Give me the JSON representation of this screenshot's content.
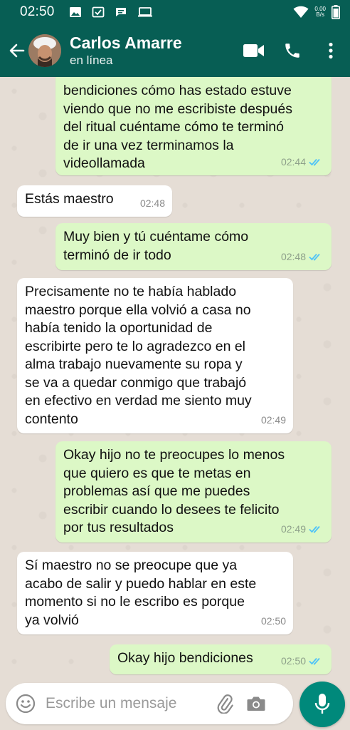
{
  "status_bar": {
    "time": "02:50",
    "net_speed_value": "0.00",
    "net_speed_unit": "B/s",
    "icons": [
      "gallery-icon",
      "checkbox-icon",
      "message-icon",
      "laptop-icon",
      "wifi-icon",
      "battery-icon"
    ]
  },
  "header": {
    "contact_name": "Carlos Amarre",
    "contact_status": "en línea",
    "icons": [
      "back-arrow-icon",
      "video-call-icon",
      "phone-icon",
      "more-options-icon"
    ]
  },
  "messages": [
    {
      "direction": "out",
      "text": "bendiciones cómo has estado estuve\nviendo que no me escribiste después\ndel ritual cuéntame cómo te terminó\nde ir una vez terminamos la\nvideollamada",
      "time": "02:44",
      "read": true
    },
    {
      "direction": "in",
      "text": "Estás maestro",
      "time": "02:48"
    },
    {
      "direction": "out",
      "text": "Muy bien y tú cuéntame cómo\nterminó de ir todo",
      "time": "02:48",
      "read": true
    },
    {
      "direction": "in",
      "text": "Precisamente no te había hablado\nmaestro porque ella volvió a casa no\nhabía tenido la oportunidad de\nescribirte pero te lo agradezco en el\nalma trabajo nuevamente su ropa y\nse va a quedar conmigo que trabajó\nen efectivo en verdad me siento muy\ncontento",
      "time": "02:49"
    },
    {
      "direction": "out",
      "text": "Okay hijo no te preocupes lo menos\nque quiero es que te metas en\nproblemas así que me puedes\nescribir cuando lo desees te felicito\npor tus resultados",
      "time": "02:49",
      "read": true
    },
    {
      "direction": "in",
      "text": "Sí maestro no se preocupe que ya\nacabo de salir y puedo hablar en este\nmomento si no le escribo es porque\nya volvió",
      "time": "02:50"
    },
    {
      "direction": "out",
      "text": "Okay hijo bendiciones",
      "time": "02:50",
      "read": true
    }
  ],
  "composer": {
    "placeholder": "Escribe un mensaje",
    "icons": [
      "emoji-icon",
      "attach-icon",
      "camera-icon",
      "mic-icon"
    ]
  },
  "colors": {
    "header": "#075e54",
    "outgoing_bubble": "#dcf8c6",
    "incoming_bubble": "#ffffff",
    "chat_background": "#e5ddd5",
    "read_ticks": "#4fc3f7",
    "mic_button": "#00897b"
  }
}
